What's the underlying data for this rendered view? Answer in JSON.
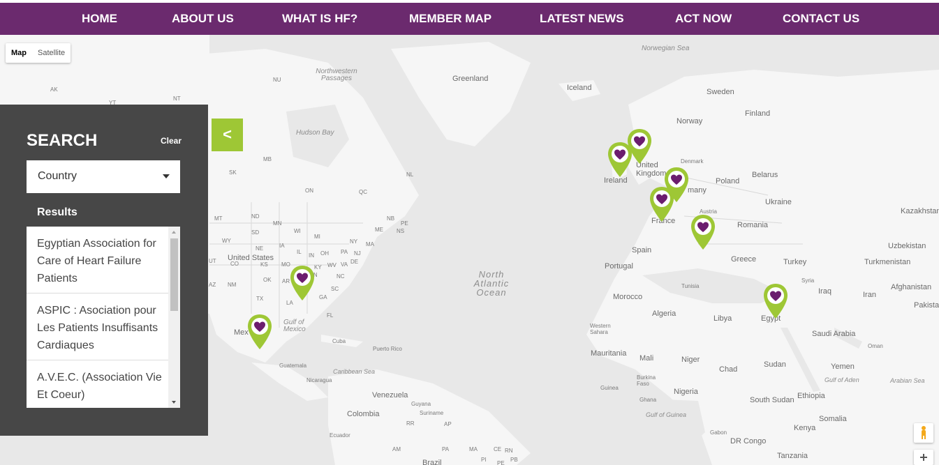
{
  "nav": {
    "items": [
      "HOME",
      "ABOUT US",
      "WHAT IS HF?",
      "MEMBER MAP",
      "LATEST NEWS",
      "ACT NOW",
      "CONTACT US"
    ]
  },
  "map_type": {
    "map": "Map",
    "satellite": "Satellite"
  },
  "search": {
    "title": "SEARCH",
    "clear": "Clear",
    "country_value": "Country",
    "results_label": "Results",
    "results": [
      "Egyptian Association for Care of Heart Failure Patients",
      "ASPIC : Asociation pour Les Patients Insuffisants Cardiaques",
      "A.V.E.C. (Association Vie Et Coeur)"
    ]
  },
  "panel_toggle": "<",
  "map_labels": {
    "norwegian_sea": "Norwegian Sea",
    "northwestern_passages": "Northwestern Passages",
    "greenland": "Greenland",
    "iceland": "Iceland",
    "sweden": "Sweden",
    "finland": "Finland",
    "norway": "Norway",
    "hudson_bay": "Hudson Bay",
    "denmark": "Denmark",
    "united_kingdom": "United Kingdom",
    "ireland": "Ireland",
    "germany": "many",
    "poland": "Poland",
    "belarus": "Belarus",
    "ukraine": "Ukraine",
    "kazakhstan": "Kazakhstan",
    "france": "France",
    "austria": "Austria",
    "romania": "Romania",
    "uzbekistan": "Uzbekistan",
    "turkmenistan": "Turkmenistan",
    "spain": "Spain",
    "portugal": "Portugal",
    "greece": "Greece",
    "turkey": "Turkey",
    "syria": "Syria",
    "iraq": "Iraq",
    "iran": "Iran",
    "afghanistan": "Afghanistan",
    "pakistan": "Pakista",
    "tunisia": "Tunisia",
    "morocco": "Morocco",
    "algeria": "Algeria",
    "libya": "Libya",
    "egypt": "Egypt",
    "saudi_arabia": "Saudi Arabia",
    "oman": "Oman",
    "western_sahara": "Western Sahara",
    "mauritania": "Mauritania",
    "mali": "Mali",
    "niger": "Niger",
    "chad": "Chad",
    "sudan": "Sudan",
    "yemen": "Yemen",
    "gulf_of_aden": "Gulf of Aden",
    "arabian_sea": "Arabian Sea",
    "burkina_faso": "Burkina Faso",
    "guinea": "Guinea",
    "ghana": "Ghana",
    "nigeria": "Nigeria",
    "south_sudan": "South Sudan",
    "ethiopia": "Ethiopia",
    "somalia": "Somalia",
    "gulf_of_guinea": "Gulf of Guinea",
    "kenya": "Kenya",
    "gabon": "Gabon",
    "dr_congo": "DR Congo",
    "tanzania": "Tanzania",
    "north_atlantic": "North Atlantic Ocean",
    "united_states": "United States",
    "gulf_of_mexico": "Gulf of Mexico",
    "cuba": "Cuba",
    "puerto_rico": "Puerto Rico",
    "caribbean_sea": "Caribbean Sea",
    "guatemala": "Guatemala",
    "nicaragua": "Nicaragua",
    "venezuela": "Venezuela",
    "guyana": "Guyana",
    "suriname": "Suriname",
    "colombia": "Colombia",
    "ecuador": "Ecuador",
    "brazil": "Brazil",
    "mexico": "Mex",
    "ak": "AK",
    "yt": "YT",
    "nt": "NT",
    "nu": "NU",
    "mb": "MB",
    "sk": "SK",
    "on": "ON",
    "qc": "QC",
    "nl": "NL",
    "nb": "NB",
    "pe": "PE",
    "ns": "NS",
    "me": "ME",
    "ma": "MA",
    "ny": "NY",
    "nd": "ND",
    "mn": "MN",
    "wi": "WI",
    "mi": "MI",
    "sd": "SD",
    "mt": "MT",
    "wy": "WY",
    "ne": "NE",
    "ia": "IA",
    "il": "IL",
    "in": "IN",
    "oh": "OH",
    "pa": "PA",
    "nj": "NJ",
    "de": "DE",
    "co": "CO",
    "ks": "KS",
    "mo": "MO",
    "ky": "KY",
    "wv": "WV",
    "va": "VA",
    "nm": "NM",
    "ok": "OK",
    "ar": "AR",
    "tn": "TN",
    "nc": "NC",
    "sc": "SC",
    "tx": "TX",
    "la": "LA",
    "ms": "MS",
    "al": "AL",
    "ga": "GA",
    "fl": "FL",
    "az": "AZ",
    "ut": "UT",
    "rr": "RR",
    "ap": "AP",
    "am": "AM",
    "pa2": "PA",
    "ma2": "MA",
    "ce": "CE",
    "rn": "RN",
    "pi": "PI",
    "pb": "PB",
    "pe2": "PE"
  },
  "pins_count": 8,
  "colors": {
    "nav_bg": "#6b2a6e",
    "panel_bg": "#474747",
    "accent_green": "#9ec735",
    "pin_heart": "#6b1d6e"
  },
  "icons": {
    "pegman": "pegman-icon",
    "zoom_in": "plus-icon",
    "select_caret": "chevron-down-icon"
  }
}
